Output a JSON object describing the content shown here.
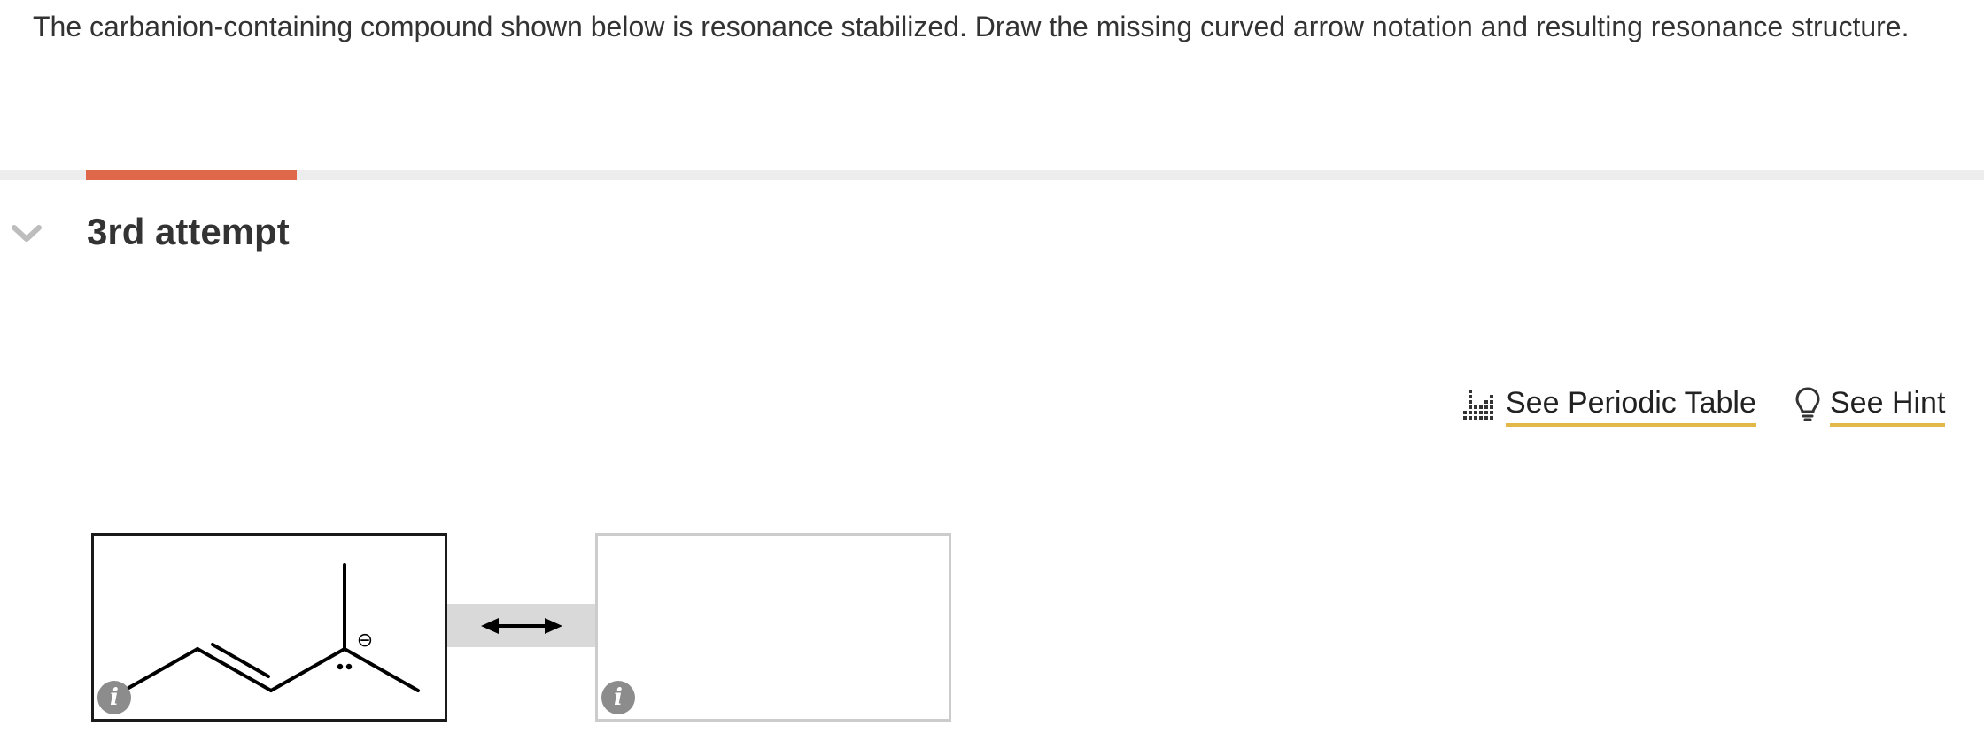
{
  "question": {
    "text": "The carbanion-containing compound shown below is resonance stabilized. Draw the missing curved arrow notation and resulting resonance structure."
  },
  "attempt": {
    "title": "3rd attempt",
    "progress": 0.1
  },
  "tools": {
    "periodic_table_label": "See Periodic Table",
    "hint_label": "See Hint"
  },
  "molecules": {
    "charge_symbol": "⊖",
    "info_glyph": "i"
  },
  "colors": {
    "accent": "#e0684a",
    "link_underline": "#e2b84a",
    "info_icon": "#8c8c8c"
  }
}
